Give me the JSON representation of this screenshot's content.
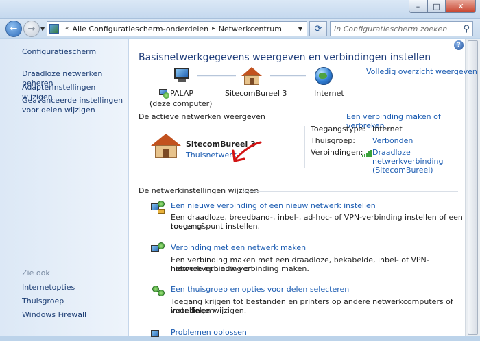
{
  "window": {
    "minimize": "–",
    "maximize": "□",
    "close": "✕"
  },
  "nav": {
    "breadcrumb_root": "Alle Configuratiescherm-onderdelen",
    "breadcrumb_current": "Netwerkcentrum",
    "search_placeholder": "In Configuratiescherm zoeken"
  },
  "sidebar": {
    "home": "Configuratiescherm",
    "items": [
      "Draadloze netwerken beheren",
      "Adapterinstellingen wijzigen",
      "Geavanceerde instellingen voor delen wijzigen"
    ],
    "see_also_label": "Zie ook",
    "see_also": [
      "Internetopties",
      "Thuisgroep",
      "Windows Firewall"
    ]
  },
  "main": {
    "title": "Basisnetwerkgegevens weergeven en verbindingen instellen",
    "full_overview": "Volledig overzicht weergeven",
    "map": {
      "pc_name": "PALAP",
      "pc_sub": "(deze computer)",
      "network": "SitecomBureel  3",
      "internet": "Internet"
    },
    "active": {
      "heading": "De actieve netwerken weergeven",
      "connect_link": "Een verbinding maken of verbreken",
      "network_name": "SitecomBureel 3",
      "network_type": "Thuisnetwerk",
      "access_type_label": "Toegangstype:",
      "access_type_value": "Internet",
      "homegroup_label": "Thuisgroep:",
      "homegroup_value": "Verbonden",
      "connections_label": "Verbindingen:",
      "connections_value_1": "Draadloze",
      "connections_value_2": "netwerkverbinding",
      "connections_value_3": "(SitecomBureel)"
    },
    "change": {
      "heading": "De netwerkinstellingen wijzigen",
      "tasks": [
        {
          "link": "Een nieuwe verbinding of een nieuw netwerk instellen",
          "desc1": "Een draadloze, breedband-, inbel-, ad-hoc- of VPN-verbinding instellen of een router of",
          "desc2": "toegangspunt instellen."
        },
        {
          "link": "Verbinding met een netwerk maken",
          "desc1": "Een verbinding maken met een draadloze, bekabelde, inbel- of VPN-netwerkverbinding of",
          "desc2": "hiermee opnieuw verbinding maken."
        },
        {
          "link": "Een thuisgroep en opties voor delen selecteren",
          "desc1": "Toegang krijgen tot bestanden en printers op andere netwerkcomputers of instellingen",
          "desc2": "voor delen wijzigen."
        },
        {
          "link": "Problemen oplossen"
        }
      ]
    }
  },
  "colors": {
    "link": "#1a5bb1",
    "annotation_arrow": "#d21414"
  },
  "icons": [
    "back-icon",
    "forward-icon",
    "refresh-icon",
    "search-icon",
    "help-icon",
    "computer-icon",
    "home-network-icon",
    "internet-globe-icon",
    "signal-icon"
  ]
}
